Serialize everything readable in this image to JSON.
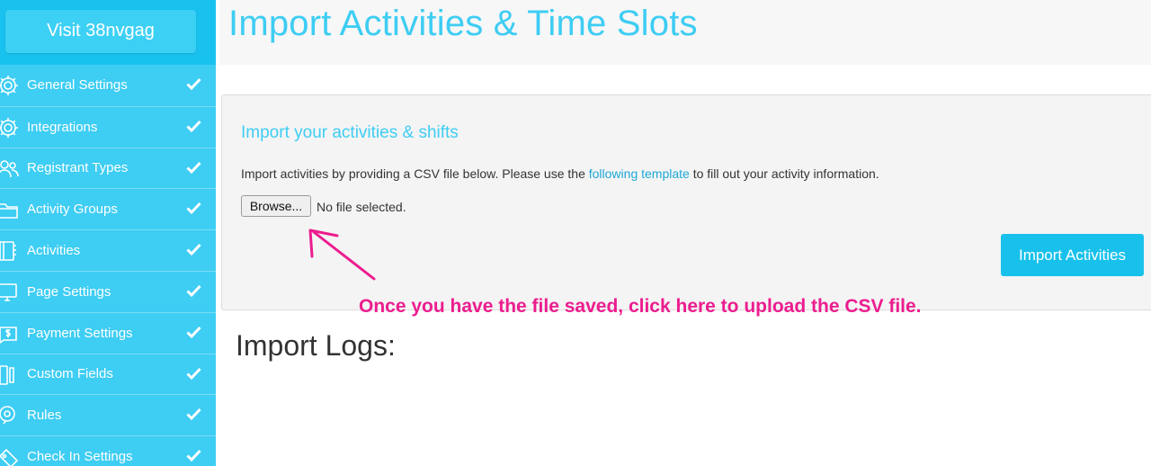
{
  "sidebar": {
    "visit_label": "Visit 38nvgag",
    "items": [
      {
        "label": "General Settings",
        "icon": "gear-icon"
      },
      {
        "label": "Integrations",
        "icon": "gear-icon"
      },
      {
        "label": "Registrant Types",
        "icon": "users-icon"
      },
      {
        "label": "Activity Groups",
        "icon": "folder-icon"
      },
      {
        "label": "Activities",
        "icon": "notebook-icon"
      },
      {
        "label": "Page Settings",
        "icon": "monitor-icon"
      },
      {
        "label": "Payment Settings",
        "icon": "payment-icon"
      },
      {
        "label": "Custom Fields",
        "icon": "custom-fields-icon"
      },
      {
        "label": "Rules",
        "icon": "rules-icon"
      },
      {
        "label": "Check In Settings",
        "icon": "check-in-icon"
      }
    ]
  },
  "header": {
    "title": "Import Activities & Time Slots"
  },
  "import_panel": {
    "title": "Import your activities & shifts",
    "desc_before": "Import activities by providing a CSV file below. Please use the ",
    "desc_link": "following template",
    "desc_after": " to fill out your activity information.",
    "browse_label": "Browse...",
    "file_status": "No file selected.",
    "import_button_label": "Import Activities"
  },
  "annotation": {
    "text": "Once you have the file saved, click here to upload the CSV file."
  },
  "logs": {
    "title": "Import Logs:"
  },
  "colors": {
    "accent": "#3ecdf3",
    "sidebar_header": "#19c2ee",
    "button": "#18c1ec",
    "annotation": "#ec1d8f",
    "link": "#1ea8d6"
  }
}
